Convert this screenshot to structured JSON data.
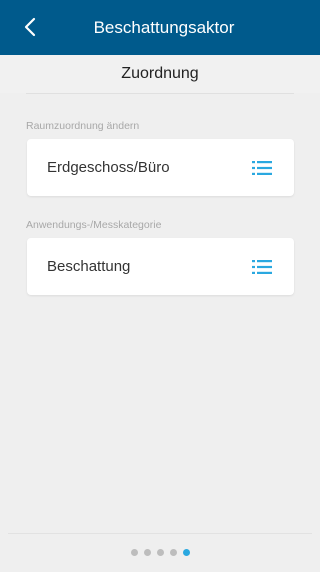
{
  "header": {
    "title": "Beschattungsaktor",
    "back_icon": "chevron-left-icon",
    "background_color": "#005a8c"
  },
  "subheader": {
    "title": "Zuordnung"
  },
  "sections": [
    {
      "label": "Raumzuordnung ändern",
      "value": "Erdgeschoss/Büro",
      "icon": "list-icon"
    },
    {
      "label": "Anwendungs-/Messkategorie",
      "value": "Beschattung",
      "icon": "list-icon"
    }
  ],
  "pager": {
    "total_pages": 5,
    "active_page": 5,
    "active_color": "#2aa8e0",
    "inactive_color": "#bdbdbd"
  }
}
